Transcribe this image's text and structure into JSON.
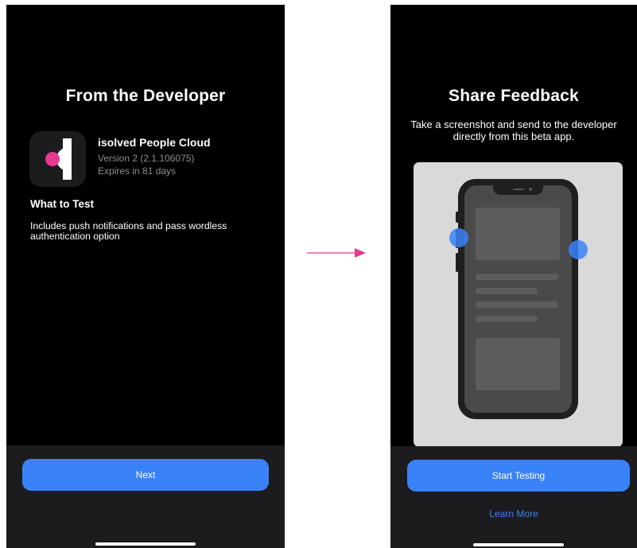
{
  "left_screen": {
    "title": "From the Developer",
    "app": {
      "name": "isolved People Cloud",
      "version": "Version 2 (2.1.106075)",
      "expires": "Expires in 81 days"
    },
    "what_to_test": {
      "heading": "What to Test",
      "body": "Includes push notifications and pass wordless authentication option"
    },
    "next_button": "Next"
  },
  "right_screen": {
    "title": "Share Feedback",
    "subtitle": "Take a screenshot and send to the developer directly from this beta app.",
    "start_button": "Start Testing",
    "learn_more_link": "Learn More"
  },
  "colors": {
    "accent": "#3a82f7",
    "arrow": "#e6398f",
    "brand_pink": "#e6398f"
  },
  "icons": [
    "app-icon",
    "phone-illustration",
    "arrow-right-icon"
  ]
}
